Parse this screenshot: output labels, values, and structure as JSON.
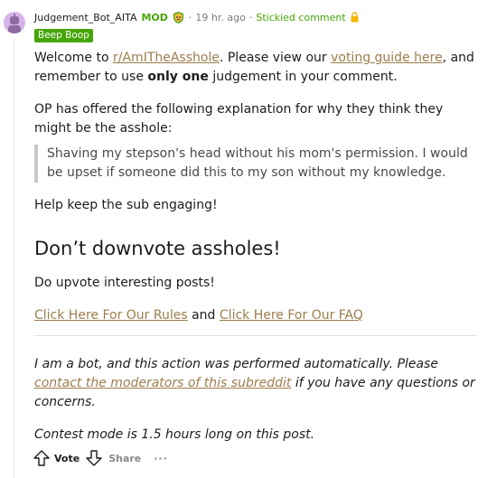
{
  "comment": {
    "username": "Judgement_Bot_AITA",
    "mod_label": "MOD",
    "time": "19 hr. ago",
    "separator": "·",
    "stickied": "Stickied comment",
    "flair": "Beep Boop"
  },
  "body": {
    "p1": {
      "t1": "Welcome to ",
      "link1": "r/AmITheAsshole",
      "t2": ". Please view our ",
      "link2": "voting guide here",
      "t3": ", and remember to use ",
      "bold": "only one",
      "t4": " judgement in your comment."
    },
    "p2": "OP has offered the following explanation for why they think they might be the asshole:",
    "quote": "Shaving my stepson's head without his mom's permission. I would be upset if someone did this to my son without my knowledge.",
    "p3": "Help keep the sub engaging!",
    "heading": "Don’t downvote assholes!",
    "p4": "Do upvote interesting posts!",
    "p5": {
      "link_rules": "Click Here For Our Rules",
      "and": " and ",
      "link_faq": "Click Here For Our FAQ"
    },
    "p6": {
      "t1": "I am a bot, and this action was performed automatically. Please ",
      "link": "contact the moderators of this subreddit",
      "t2": " if you have any questions or concerns."
    },
    "p7": "Contest mode is 1.5 hours long on this post."
  },
  "actions": {
    "vote_label": "Vote",
    "share_label": "Share",
    "more_label": "···"
  },
  "colors": {
    "mod_green": "#46a508",
    "link": "#9c7d4c",
    "meta_gray": "#7c7c7c"
  }
}
